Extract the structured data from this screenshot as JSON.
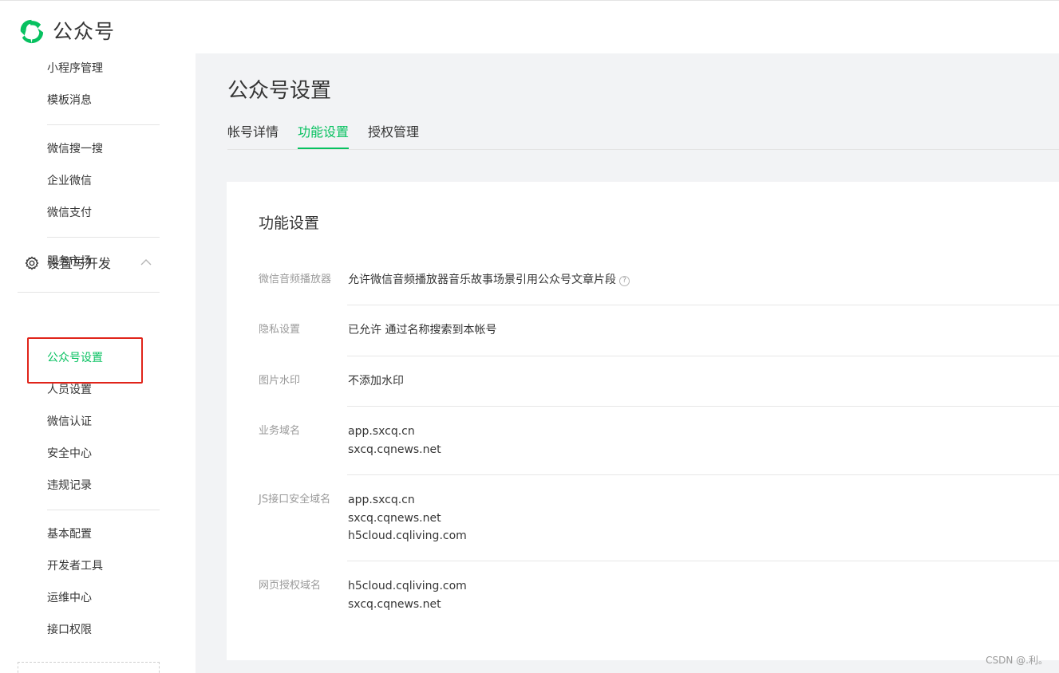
{
  "header": {
    "brand": "公众号"
  },
  "sidebar": {
    "items_top": [
      "小程序管理",
      "模板消息"
    ],
    "items_mid": [
      "微信搜一搜",
      "企业微信",
      "微信支付"
    ],
    "items_market": [
      "服务市场"
    ],
    "group": {
      "label": "设置与开发",
      "icon": "gear-icon"
    },
    "group_items": [
      "公众号设置",
      "人员设置",
      "微信认证",
      "安全中心",
      "违规记录"
    ],
    "group_items2": [
      "基本配置",
      "开发者工具",
      "运维中心",
      "接口权限"
    ],
    "active": "公众号设置"
  },
  "main": {
    "title": "公众号设置",
    "tabs": [
      {
        "label": "帐号详情",
        "active": false
      },
      {
        "label": "功能设置",
        "active": true
      },
      {
        "label": "授权管理",
        "active": false
      }
    ]
  },
  "card": {
    "title": "功能设置",
    "rows": [
      {
        "label": "微信音频播放器",
        "values": [
          "允许微信音频播放器音乐故事场景引用公众号文章片段"
        ],
        "help": "?"
      },
      {
        "label": "隐私设置",
        "values": [
          "已允许 通过名称搜索到本帐号"
        ]
      },
      {
        "label": "图片水印",
        "values": [
          "不添加水印"
        ]
      },
      {
        "label": "业务域名",
        "values": [
          "app.sxcq.cn",
          "sxcq.cqnews.net"
        ]
      },
      {
        "label": "JS接口安全域名",
        "values": [
          "app.sxcq.cn",
          "sxcq.cqnews.net",
          "h5cloud.cqliving.com"
        ]
      },
      {
        "label": "网页授权域名",
        "values": [
          "h5cloud.cqliving.com",
          "sxcq.cqnews.net"
        ]
      }
    ]
  },
  "watermark": "CSDN @.利。",
  "colors": {
    "accent": "#07c160",
    "highlight": "#e0241a"
  }
}
